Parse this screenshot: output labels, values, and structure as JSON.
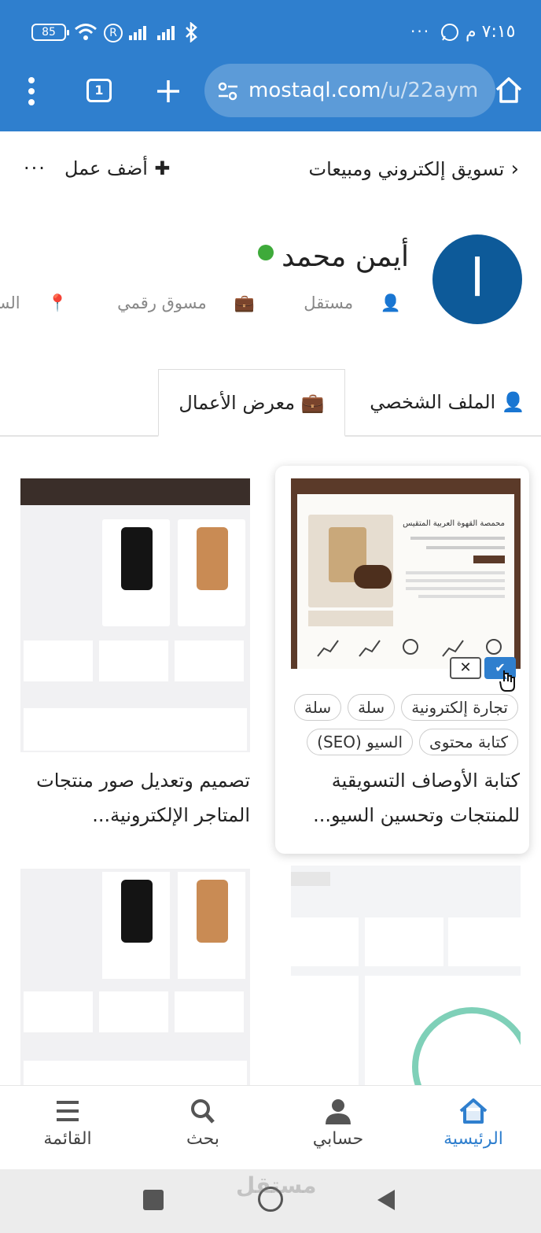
{
  "status": {
    "time": "٧:١٥ م",
    "battery": "85"
  },
  "browser": {
    "url_host": "mostaql.com",
    "url_path": "/u/22aym",
    "tab_count": "1"
  },
  "topnav": {
    "breadcrumb": "تسويق إلكتروني ومبيعات",
    "add_work": "أضف عمل",
    "more": "···"
  },
  "profile": {
    "avatar_letter": "ا",
    "name": "أيمن محمد",
    "role": "مستقل",
    "title": "مسوق رقمي",
    "location": "السعودية"
  },
  "tabs": [
    {
      "label": "الملف الشخصي"
    },
    {
      "label": "معرض الأعمال"
    }
  ],
  "cards": [
    {
      "tags": [
        "تجارة إلكترونية",
        "سلة",
        "سلة",
        "كتابة محتوى",
        "السيو (SEO)"
      ],
      "title": "كتابة الأوصاف التسويقية للمنتجات وتحسين السيو...",
      "thumb_title": "محمصة القهوة العربية المتقيس"
    },
    {
      "title": "تصميم وتعديل صور منتجات المتاجر الإلكترونية..."
    }
  ],
  "bottom_nav": [
    {
      "label": "الرئيسية",
      "icon": "home-icon"
    },
    {
      "label": "حسابي",
      "icon": "user-icon"
    },
    {
      "label": "بحث",
      "icon": "search-icon"
    },
    {
      "label": "القائمة",
      "icon": "menu-icon"
    }
  ],
  "watermark": "مستقل",
  "colors": {
    "primary": "#2f7fce",
    "avatar": "#0d5a99",
    "online": "#3eaa3a",
    "check": "#2f7fce",
    "coffee": "#5b3a29"
  }
}
